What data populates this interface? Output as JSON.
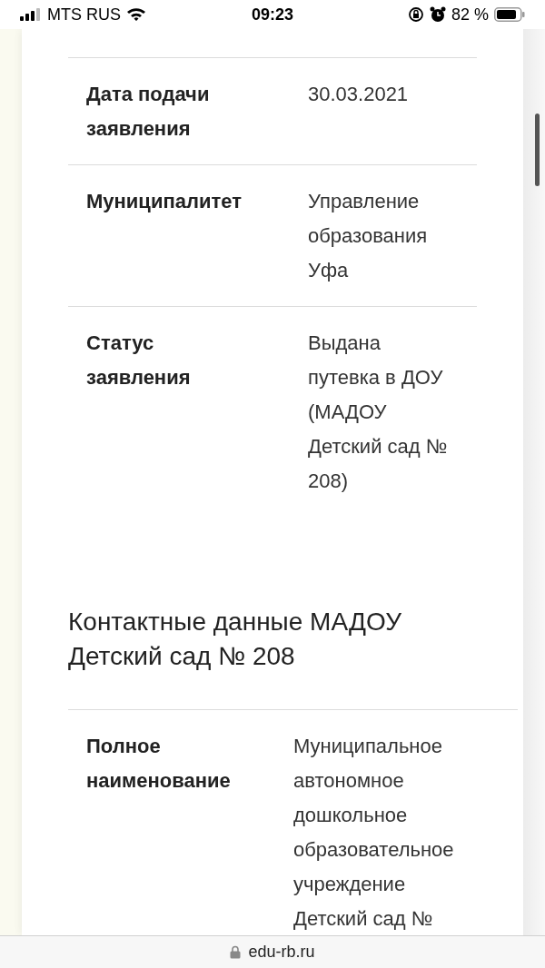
{
  "status_bar": {
    "carrier": "MTS RUS",
    "time": "09:23",
    "battery": "82 %"
  },
  "application_table": {
    "rows": [
      {
        "label": "Дата подачи заявления",
        "value": "30.03.2021"
      },
      {
        "label": "Муниципалитет",
        "value": "Управление образования Уфа"
      },
      {
        "label": "Статус заявления",
        "value": "Выдана путевка в ДОУ (МАДОУ Детский сад № 208)"
      }
    ]
  },
  "contacts_heading": "Контактные данные МАДОУ Детский сад № 208",
  "contacts_table": {
    "rows": [
      {
        "label": "Полное наименование",
        "value": "Муниципальное автономное дошкольное образовательное учреждение Детский сад №"
      }
    ]
  },
  "address_bar": {
    "url": "edu-rb.ru"
  }
}
